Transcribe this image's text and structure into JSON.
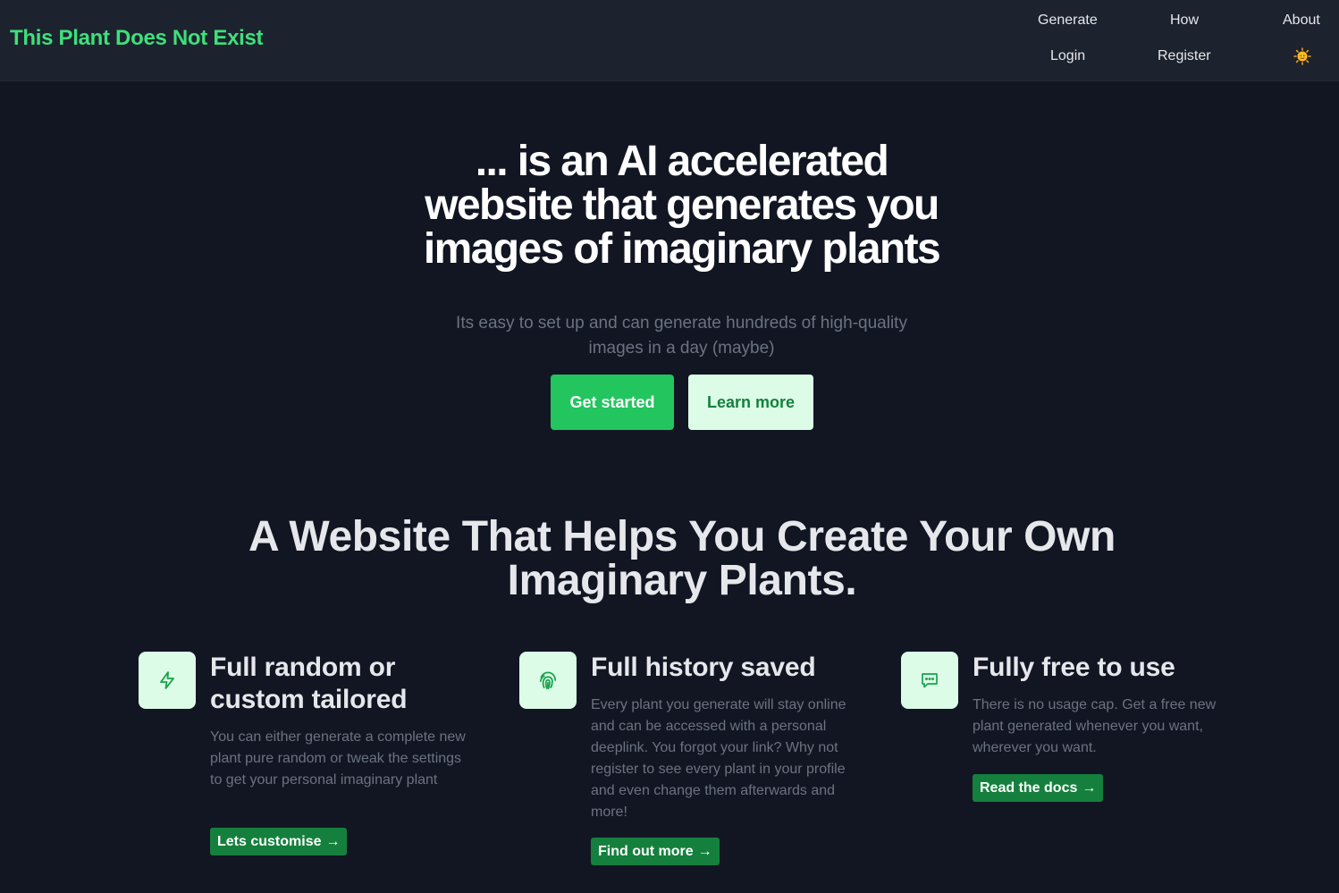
{
  "header": {
    "brand": "This Plant Does Not Exist",
    "nav": {
      "generate": "Generate",
      "how": "How",
      "about": "About",
      "login": "Login",
      "register": "Register"
    },
    "theme_icon": "sun-icon"
  },
  "hero": {
    "title": "... is an AI accelerated website that generates you images of imaginary plants",
    "subtitle": "Its easy to set up and can generate hundreds of high-quality images in a day (maybe)",
    "primary_button": "Get started",
    "secondary_button": "Learn more"
  },
  "section": {
    "title": "A Website That Helps You Create Your Own Imaginary Plants."
  },
  "features": [
    {
      "icon": "lightning-icon",
      "title": "Full random or custom tailored",
      "description": "You can either generate a complete new plant pure random or tweak the settings to get your personal imaginary plant",
      "link": "Lets customise"
    },
    {
      "icon": "fingerprint-icon",
      "title": "Full history saved",
      "description": "Every plant you generate will stay online and can be accessed with a personal deeplink. You forgot your link? Why not register to see every plant in your profile and even change them afterwards and more!",
      "link": "Find out more"
    },
    {
      "icon": "chat-icon",
      "title": "Fully free to use",
      "description": "There is no usage cap. Get a free new plant generated whenever you want, wherever you want.",
      "link": "Read the docs"
    }
  ],
  "link_arrow": "→",
  "colors": {
    "background": "#121623",
    "header": "#1d222f",
    "brand": "#3ee07a",
    "primary": "#22c55e",
    "primary_light": "#dcfce7",
    "link_bg": "#15803d",
    "muted_text": "#6b7280"
  }
}
